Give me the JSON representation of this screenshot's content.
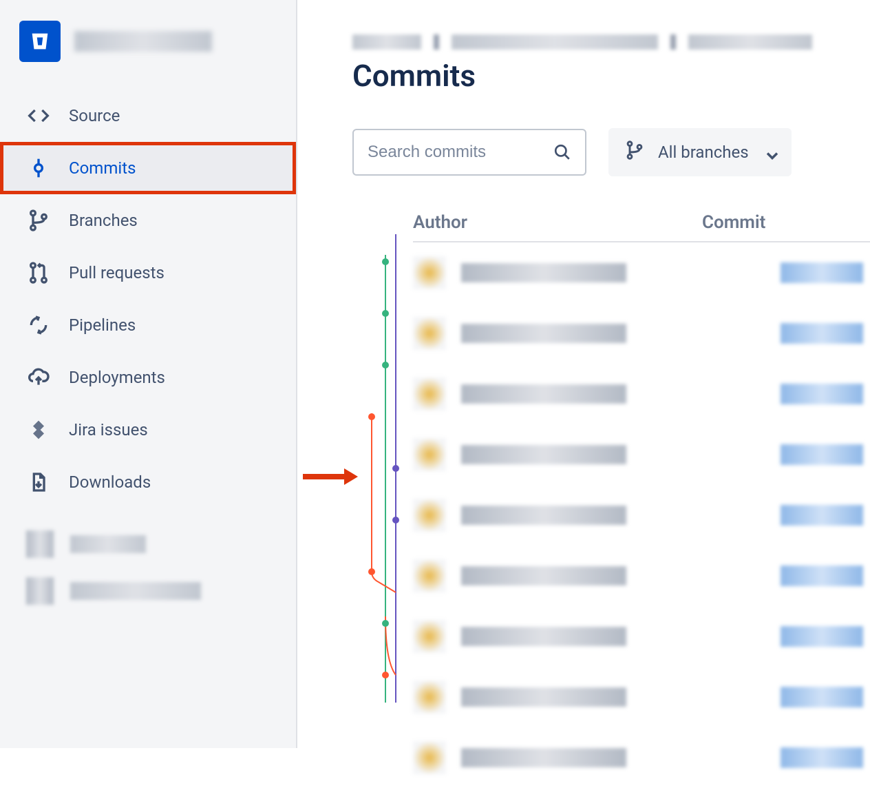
{
  "sidebar": {
    "items": [
      {
        "label": "Source"
      },
      {
        "label": "Commits"
      },
      {
        "label": "Branches"
      },
      {
        "label": "Pull requests"
      },
      {
        "label": "Pipelines"
      },
      {
        "label": "Deployments"
      },
      {
        "label": "Jira issues"
      },
      {
        "label": "Downloads"
      }
    ]
  },
  "page": {
    "title": "Commits"
  },
  "search": {
    "placeholder": "Search commits"
  },
  "branch_filter": {
    "label": "All branches"
  },
  "table": {
    "headers": {
      "author": "Author",
      "commit": "Commit"
    }
  }
}
